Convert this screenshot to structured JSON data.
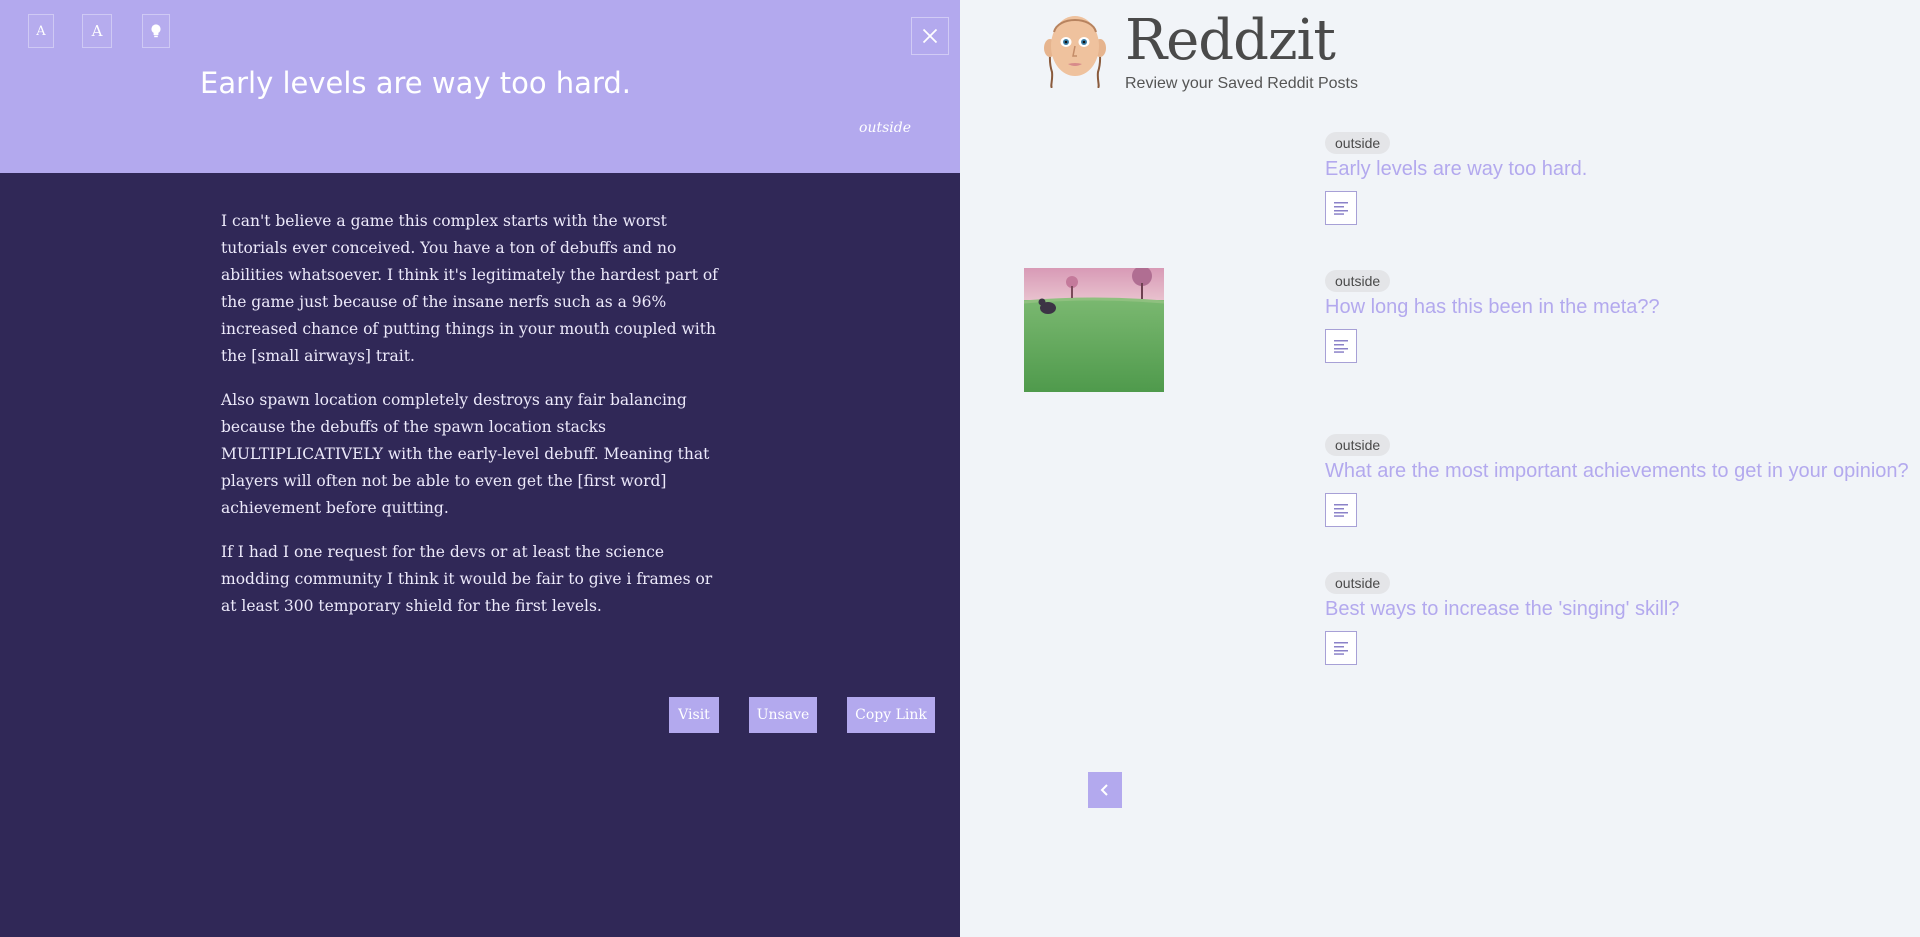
{
  "toolbar": {
    "font_small_label": "A",
    "font_large_label": "A",
    "theme_icon": "lightbulb-icon",
    "close_icon": "close-icon"
  },
  "reader": {
    "title": "Early levels are way too hard.",
    "subreddit": "outside",
    "paragraphs": [
      "I can't believe a game this complex starts with the worst tutorials ever conceived. You have a ton of debuffs and no abilities whatsoever. I think it's legitimately the hardest part of the game just because of the insane nerfs such as a 96% increased chance of putting things in your mouth coupled with the [small airways] trait.",
      "Also spawn location completely destroys any fair balancing because the debuffs of the spawn location stacks MULTIPLICATIVELY with the early-level debuff. Meaning that players will often not be able to even get the [first word] achievement before quitting.",
      "If I had I one request for the devs or at least the science modding community I think it would be fair to give i frames or at least 300 temporary shield for the first levels."
    ],
    "actions": {
      "visit": "Visit",
      "unsave": "Unsave",
      "copy_link": "Copy Link"
    }
  },
  "app": {
    "title": "Reddzit",
    "tagline": "Review your Saved Reddit Posts"
  },
  "posts": [
    {
      "tag": "outside",
      "title": "Early levels are way too hard.",
      "icon": "text-post-icon"
    },
    {
      "tag": "outside",
      "title": "How long has this been in the meta??",
      "icon": "text-post-icon",
      "thumbnail": "field-photo"
    },
    {
      "tag": "outside",
      "title": "What are the most important achievements to get in your opinion?",
      "icon": "text-post-icon"
    },
    {
      "tag": "outside",
      "title": "Best ways to increase the 'singing' skill?",
      "icon": "text-post-icon"
    }
  ],
  "pagination": {
    "prev_icon": "chevron-left-icon"
  },
  "colors": {
    "accent": "#b3a9ee",
    "reader_bg": "#302857",
    "list_bg": "#f1f4f8"
  }
}
